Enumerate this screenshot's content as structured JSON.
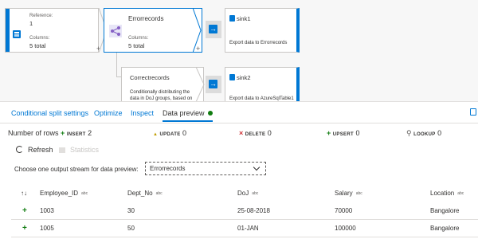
{
  "canvas": {
    "source_node": {
      "reference_label": "Reference:",
      "reference_value": "1",
      "columns_label": "Columns:",
      "columns_value": "5 total"
    },
    "split_node": {
      "name": "Errorrecords",
      "columns_label": "Columns:",
      "columns_value": "5 total"
    },
    "sink1": {
      "name": "sink1",
      "description": "Export data to Errorrecords"
    },
    "correct_node": {
      "name": "Correctrecords",
      "description_line1": "Conditionally distributing the",
      "description_line2": "data in DoJ groups, based on"
    },
    "sink2": {
      "name": "sink2",
      "description": "Export data to AzureSqlTable1"
    },
    "plus_symbol": "+"
  },
  "tabs": [
    {
      "label": "Conditional split settings",
      "active": false
    },
    {
      "label": "Optimize",
      "active": false
    },
    {
      "label": "Inspect",
      "active": false
    },
    {
      "label": "Data preview",
      "active": true
    }
  ],
  "stats": {
    "rows_label": "Number of rows",
    "insert": {
      "symbol": "+",
      "tag": "INSERT",
      "count": "2"
    },
    "update": {
      "symbol": "▲",
      "tag": "UPDATE",
      "count": "0"
    },
    "delete": {
      "symbol": "×",
      "tag": "DELETE",
      "count": "0"
    },
    "upsert": {
      "symbol": "+",
      "tag": "UPSERT",
      "count": "0"
    },
    "lookup": {
      "symbol": "⚲",
      "tag": "LOOKUP",
      "count": "0"
    }
  },
  "toolbar": {
    "refresh_label": "Refresh",
    "statistics_label": "Statistics"
  },
  "chooser": {
    "label": "Choose one output stream for data preview:",
    "selected": "Errorrecords"
  },
  "table": {
    "sort_symbol": "↑↓",
    "type_tag": "abc",
    "columns": [
      "Employee_ID",
      "Dept_No",
      "DoJ",
      "Salary",
      "Location"
    ],
    "rows": [
      {
        "marker": "+",
        "cells": [
          "1003",
          "30",
          "25-08-2018",
          "70000",
          "Bangalore"
        ]
      },
      {
        "marker": "+",
        "cells": [
          "1005",
          "50",
          "01-JAN",
          "100000",
          "Bangalore"
        ]
      }
    ]
  },
  "colors": {
    "accent": "#0078d4",
    "success": "#107c10",
    "danger": "#d13438",
    "warning": "#c19c00"
  }
}
